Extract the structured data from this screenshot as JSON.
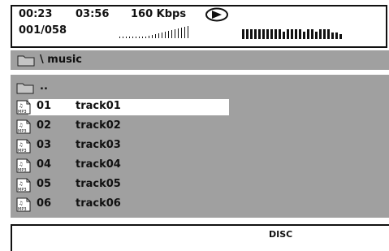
{
  "status": {
    "elapsed": "00:23",
    "total": "03:56",
    "bitrate": "160 Kbps",
    "track": "001/058",
    "play_icon": "play-icon"
  },
  "path": {
    "text": "\\ music",
    "icon": "folder-icon"
  },
  "list": {
    "parent": "..",
    "items": [
      {
        "num": "01",
        "name": "track01",
        "icon": "mp3-file-icon"
      },
      {
        "num": "02",
        "name": "track02",
        "icon": "mp3-file-icon"
      },
      {
        "num": "03",
        "name": "track03",
        "icon": "mp3-file-icon"
      },
      {
        "num": "04",
        "name": "track04",
        "icon": "mp3-file-icon"
      },
      {
        "num": "05",
        "name": "track05",
        "icon": "mp3-file-icon"
      },
      {
        "num": "06",
        "name": "track06",
        "icon": "mp3-file-icon"
      }
    ],
    "selected_index": 0
  },
  "footer": {
    "source": "DISC"
  },
  "colors": {
    "panel_gray": "#a0a0a0",
    "highlight": "#ffffff",
    "text": "#111111"
  }
}
